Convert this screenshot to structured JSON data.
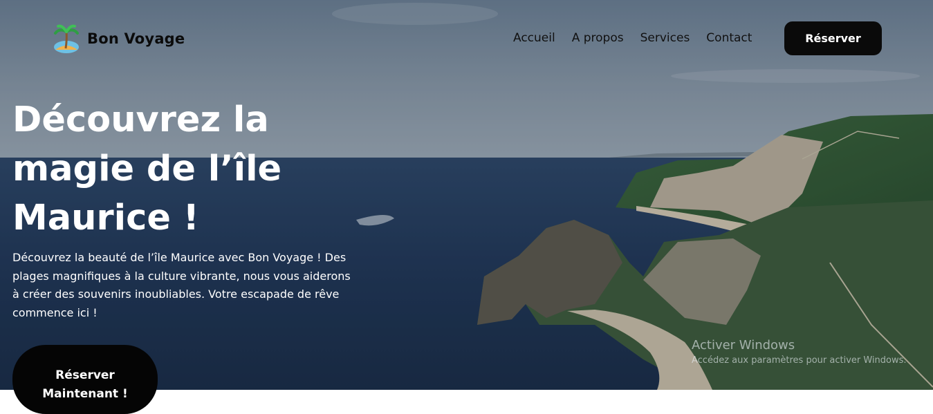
{
  "brand": {
    "name": "Bon Voyage",
    "logo_icon": "palm-island-icon"
  },
  "nav": {
    "links": [
      "Accueil",
      "A propos",
      "Services",
      "Contact"
    ],
    "book_button": "Réserver"
  },
  "hero": {
    "title": "Découvrez la magie de l’île Maurice !",
    "description": "Découvrez la beauté de l’île Maurice avec Bon Voyage ! Des plages magnifiques à la culture vibrante, nous vous aiderons à créer des souvenirs inoubliables. Votre escapade de rêve commence ici !",
    "cta": "Réserver Maintenant !"
  },
  "watermark": {
    "title": "Activer Windows",
    "subtitle": "Accédez aux paramètres pour activer Windows."
  },
  "colors": {
    "button_bg": "#0a0a0a",
    "text_dark": "#111111",
    "text_light": "#ffffff"
  }
}
